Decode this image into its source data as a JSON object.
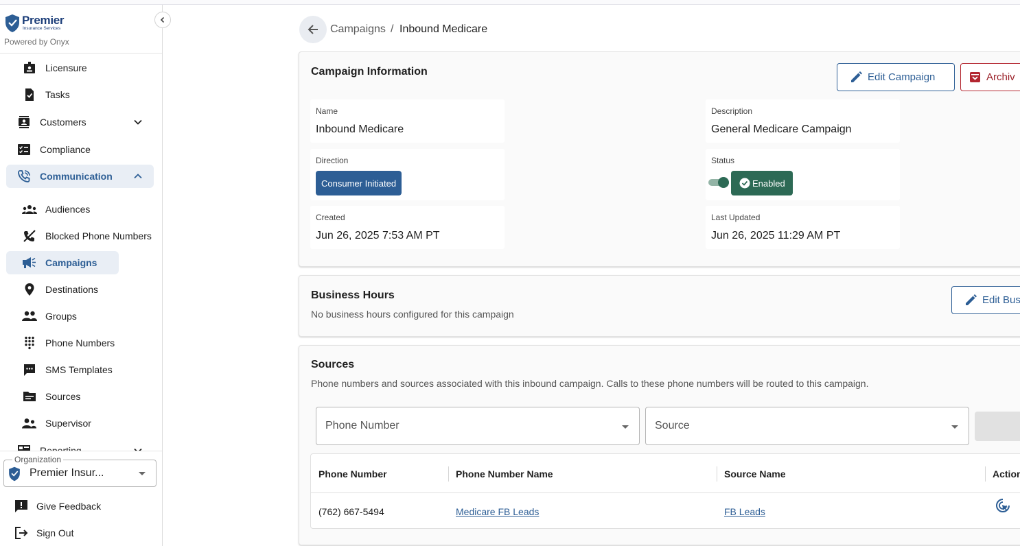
{
  "brand": {
    "name": "Premier",
    "subtitle": "Insurance Services",
    "powered_by": "Powered by Onyx"
  },
  "sidebar": {
    "items": [
      {
        "label": "Licensure",
        "icon": "id-badge-icon"
      },
      {
        "label": "Tasks",
        "icon": "task-check-icon"
      },
      {
        "label": "Customers",
        "icon": "contacts-icon"
      },
      {
        "label": "Compliance",
        "icon": "checklist-icon"
      },
      {
        "label": "Communication",
        "icon": "phone-call-icon"
      },
      {
        "label": "Audiences",
        "icon": "groups-icon"
      },
      {
        "label": "Blocked Phone Numbers",
        "icon": "phone-disabled-icon"
      },
      {
        "label": "Campaigns",
        "icon": "megaphone-icon"
      },
      {
        "label": "Destinations",
        "icon": "location-pin-icon"
      },
      {
        "label": "Groups",
        "icon": "people-icon"
      },
      {
        "label": "Phone Numbers",
        "icon": "dialpad-icon"
      },
      {
        "label": "SMS Templates",
        "icon": "sms-icon"
      },
      {
        "label": "Sources",
        "icon": "source-folder-icon"
      },
      {
        "label": "Supervisor",
        "icon": "supervisor-icon"
      },
      {
        "label": "Reporting",
        "icon": "reporting-icon"
      }
    ],
    "active": "Campaigns",
    "organization": {
      "legend": "Organization",
      "value": "Premier Insur..."
    },
    "feedback": "Give Feedback",
    "sign_out": "Sign Out"
  },
  "breadcrumb": {
    "parent": "Campaigns",
    "separator": "/",
    "current": "Inbound Medicare"
  },
  "campaign_info": {
    "title": "Campaign Information",
    "edit_label": "Edit Campaign",
    "archive_label": "Archiv",
    "name_label": "Name",
    "name_value": "Inbound Medicare",
    "description_label": "Description",
    "description_value": "General Medicare Campaign",
    "direction_label": "Direction",
    "direction_value": "Consumer Initiated",
    "status_label": "Status",
    "status_value": "Enabled",
    "status_enabled": true,
    "created_label": "Created",
    "created_value": "Jun 26, 2025 7:53 AM PT",
    "updated_label": "Last Updated",
    "updated_value": "Jun 26, 2025 11:29 AM PT"
  },
  "business_hours": {
    "title": "Business Hours",
    "empty_text": "No business hours configured for this campaign",
    "edit_label": "Edit Bus"
  },
  "sources": {
    "title": "Sources",
    "description": "Phone numbers and sources associated with this inbound campaign. Calls to these phone numbers will be routed to this campaign.",
    "phone_placeholder": "Phone Number",
    "source_placeholder": "Source",
    "columns": [
      "Phone Number",
      "Phone Number Name",
      "Source Name",
      "Action"
    ],
    "rows": [
      {
        "phone": "(762) 667-5494",
        "phone_name": "Medicare FB Leads",
        "source_name": "FB Leads"
      }
    ]
  },
  "colors": {
    "primary": "#2d5e95",
    "success": "#2d6a55",
    "danger": "#b3262f"
  }
}
